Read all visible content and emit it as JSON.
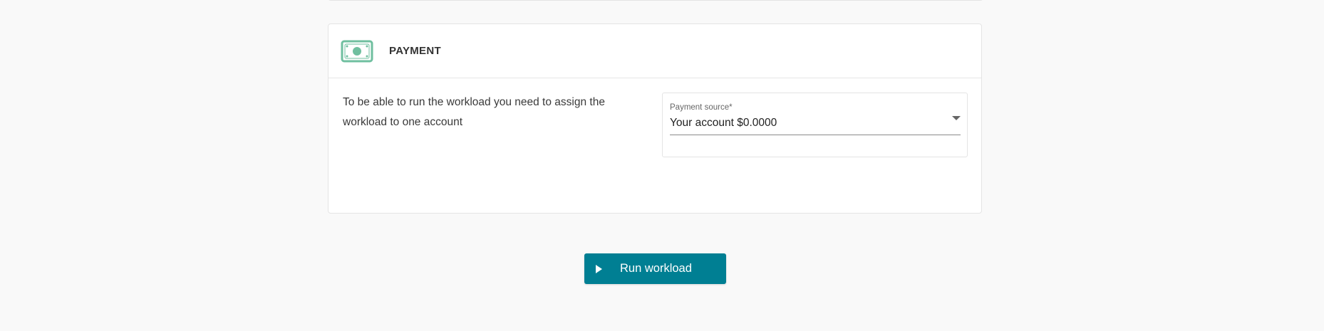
{
  "payment_card": {
    "title": "PAYMENT",
    "icon": "banknote-icon",
    "description": "To be able to run the workload you need to assign the workload to one account",
    "payment_source": {
      "label": "Payment source*",
      "value": "Your account $0.0000"
    }
  },
  "actions": {
    "run_label": "Run workload",
    "run_icon": "play-icon"
  },
  "colors": {
    "accent": "#007f93",
    "icon_green": "#6fbf9f",
    "background": "#f9f9f9"
  }
}
